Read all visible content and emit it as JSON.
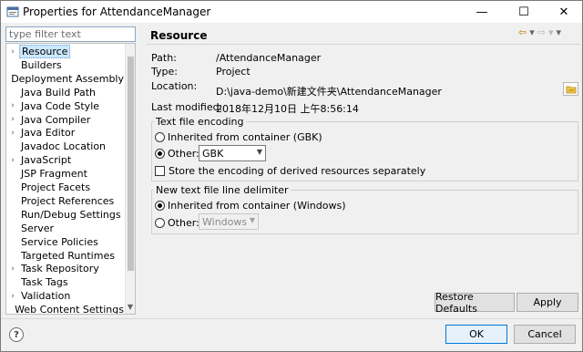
{
  "window": {
    "title": "Properties for AttendanceManager",
    "minimize": "—",
    "maximize": "☐",
    "close": "✕"
  },
  "filter": {
    "placeholder": "type filter text"
  },
  "tree": {
    "items": [
      {
        "label": "Resource",
        "expandable": true,
        "selected": true
      },
      {
        "label": "Builders",
        "expandable": false
      },
      {
        "label": "Deployment Assembly",
        "expandable": false
      },
      {
        "label": "Java Build Path",
        "expandable": false
      },
      {
        "label": "Java Code Style",
        "expandable": true
      },
      {
        "label": "Java Compiler",
        "expandable": true
      },
      {
        "label": "Java Editor",
        "expandable": true
      },
      {
        "label": "Javadoc Location",
        "expandable": false
      },
      {
        "label": "JavaScript",
        "expandable": true
      },
      {
        "label": "JSP Fragment",
        "expandable": false
      },
      {
        "label": "Project Facets",
        "expandable": false
      },
      {
        "label": "Project References",
        "expandable": false
      },
      {
        "label": "Run/Debug Settings",
        "expandable": false
      },
      {
        "label": "Server",
        "expandable": false
      },
      {
        "label": "Service Policies",
        "expandable": false
      },
      {
        "label": "Targeted Runtimes",
        "expandable": false
      },
      {
        "label": "Task Repository",
        "expandable": true
      },
      {
        "label": "Task Tags",
        "expandable": false
      },
      {
        "label": "Validation",
        "expandable": true
      },
      {
        "label": "Web Content Settings",
        "expandable": false
      }
    ]
  },
  "page": {
    "title": "Resource",
    "path_label": "Path:",
    "path_value": "/AttendanceManager",
    "type_label": "Type:",
    "type_value": "Project",
    "location_label": "Location:",
    "location_value": "D:\\java-demo\\新建文件夹\\AttendanceManager",
    "modified_label": "Last modified:",
    "modified_value": "2018年12月10日 上午8:56:14"
  },
  "encoding": {
    "group_title": "Text file encoding",
    "inherited_label": "Inherited from container (GBK)",
    "other_label": "Other:",
    "other_value": "GBK",
    "store_label": "Store the encoding of derived resources separately"
  },
  "delimiter": {
    "group_title": "New text file line delimiter",
    "inherited_label": "Inherited from container (Windows)",
    "other_label": "Other:",
    "other_value": "Windows"
  },
  "buttons": {
    "restore_defaults": "Restore Defaults",
    "apply": "Apply",
    "ok": "OK",
    "cancel": "Cancel"
  },
  "nav": {
    "back": "⇦",
    "back_menu": "▾",
    "forward": "⇨",
    "forward_menu": "▾",
    "menu": "▾"
  },
  "help": {
    "glyph": "?"
  }
}
